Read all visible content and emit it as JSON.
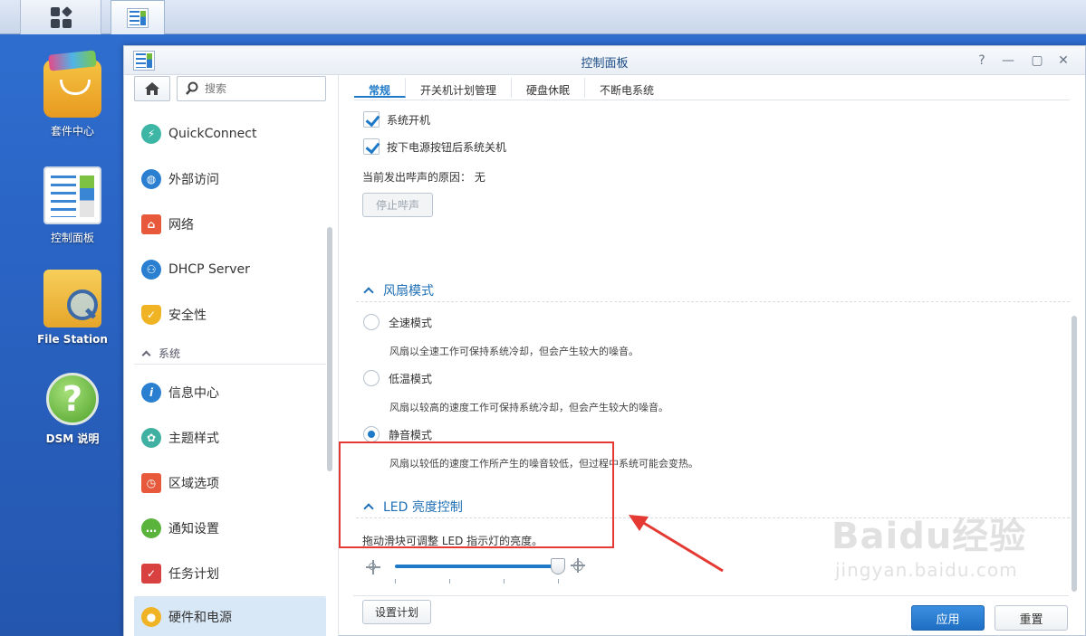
{
  "desktop": {
    "icons": [
      {
        "label": "套件中心"
      },
      {
        "label": "控制面板"
      },
      {
        "label": "File Station"
      },
      {
        "label": "DSM 说明"
      }
    ]
  },
  "window": {
    "title": "控制面板",
    "controls": {
      "help": "?",
      "minimize": "—",
      "maximize": "▢",
      "close": "✕"
    }
  },
  "sidebar": {
    "search_placeholder": "搜索",
    "items": [
      {
        "label": "QuickConnect",
        "icon": "quickconnect-icon",
        "color": "#3db6a5"
      },
      {
        "label": "外部访问",
        "icon": "globe-icon",
        "color": "#2a7fd1"
      },
      {
        "label": "网络",
        "icon": "house-icon",
        "color": "#e8593b"
      },
      {
        "label": "DHCP Server",
        "icon": "dhcp-icon",
        "color": "#2a7fd1"
      },
      {
        "label": "安全性",
        "icon": "shield-icon",
        "color": "#f0b323"
      }
    ],
    "section": "系统",
    "system_items": [
      {
        "label": "信息中心",
        "icon": "info-icon",
        "color": "#2a7fd1"
      },
      {
        "label": "主题样式",
        "icon": "palette-icon",
        "color": "#3fb0a1"
      },
      {
        "label": "区域选项",
        "icon": "clock-icon",
        "color": "#e8593b"
      },
      {
        "label": "通知设置",
        "icon": "chat-icon",
        "color": "#5ab33a"
      },
      {
        "label": "任务计划",
        "icon": "calendar-check-icon",
        "color": "#d8413f"
      },
      {
        "label": "硬件和电源",
        "icon": "bulb-icon",
        "color": "#f0b323"
      }
    ]
  },
  "tabs": [
    "常规",
    "开关机计划管理",
    "硬盘休眠",
    "不断电系统"
  ],
  "general": {
    "check_boot": "系统开机",
    "check_power_btn": "按下电源按钮后系统关机",
    "beep_reason": "当前发出哔声的原因： 无",
    "stop_beep": "停止哔声"
  },
  "fan": {
    "title": "风扇模式",
    "options": [
      {
        "label": "全速模式",
        "desc": "风扇以全速工作可保持系统冷却，但会产生较大的噪音。",
        "selected": false
      },
      {
        "label": "低温模式",
        "desc": "风扇以较高的速度工作可保持系统冷却，但会产生较大的噪音。",
        "selected": false
      },
      {
        "label": "静音模式",
        "desc": "风扇以较低的速度工作所产生的噪音较低，但过程中系统可能会变热。",
        "selected": true
      }
    ]
  },
  "led": {
    "title": "LED 亮度控制",
    "desc": "拖动滑块可调整 LED 指示灯的亮度。",
    "brightness": 1.0,
    "schedule_btn": "设置计划"
  },
  "footer": {
    "apply": "应用",
    "reset": "重置"
  },
  "watermark": {
    "text": "Baidu经验",
    "url": "jingyan.baidu.com"
  }
}
